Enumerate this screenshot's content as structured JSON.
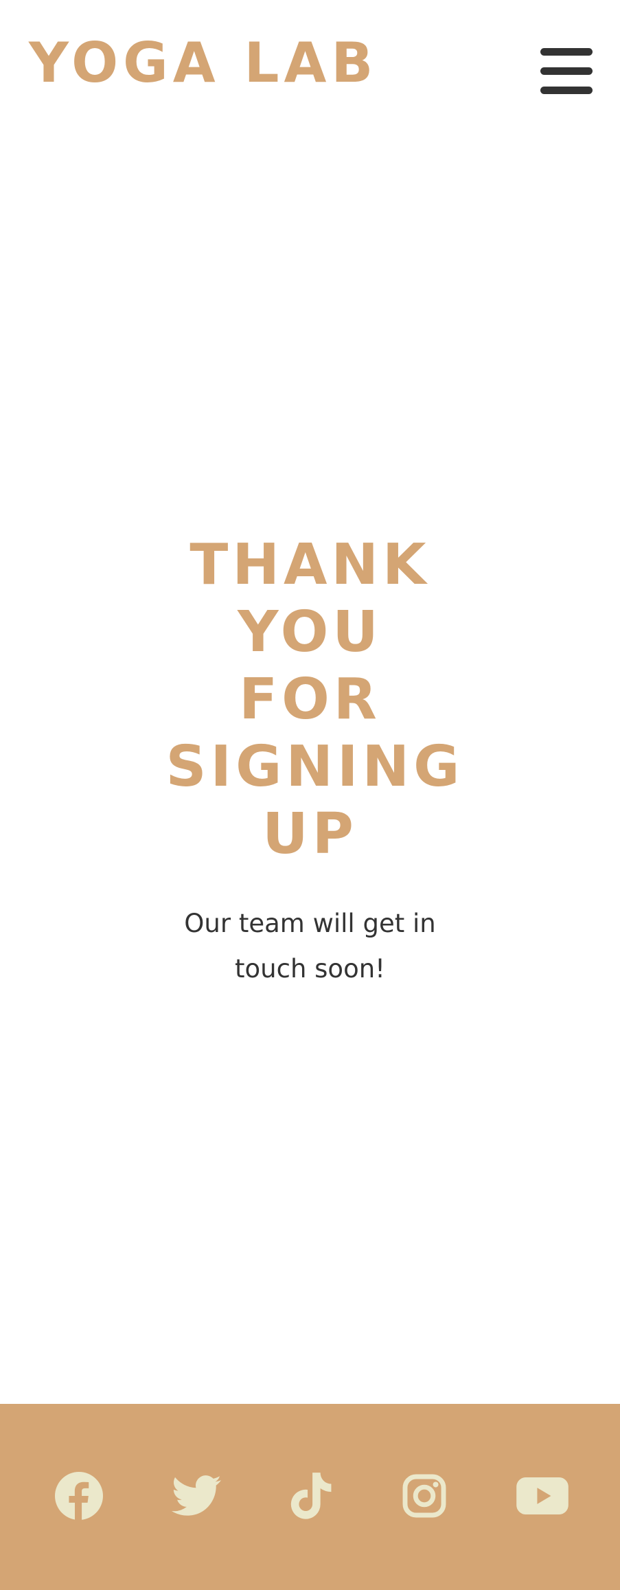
{
  "header": {
    "logo_text": "YOGA LAB",
    "menu_icon": "hamburger-menu-icon"
  },
  "main": {
    "title": "THANK YOU FOR SIGNING UP",
    "message": "Our team will get in touch soon!"
  },
  "footer": {
    "social_icons": [
      "facebook-icon",
      "twitter-icon",
      "tiktok-icon",
      "instagram-icon",
      "youtube-icon"
    ]
  },
  "colors": {
    "brand": "#d4a574",
    "text": "#333333",
    "icon": "#ebe8cb",
    "background": "#ffffff"
  }
}
